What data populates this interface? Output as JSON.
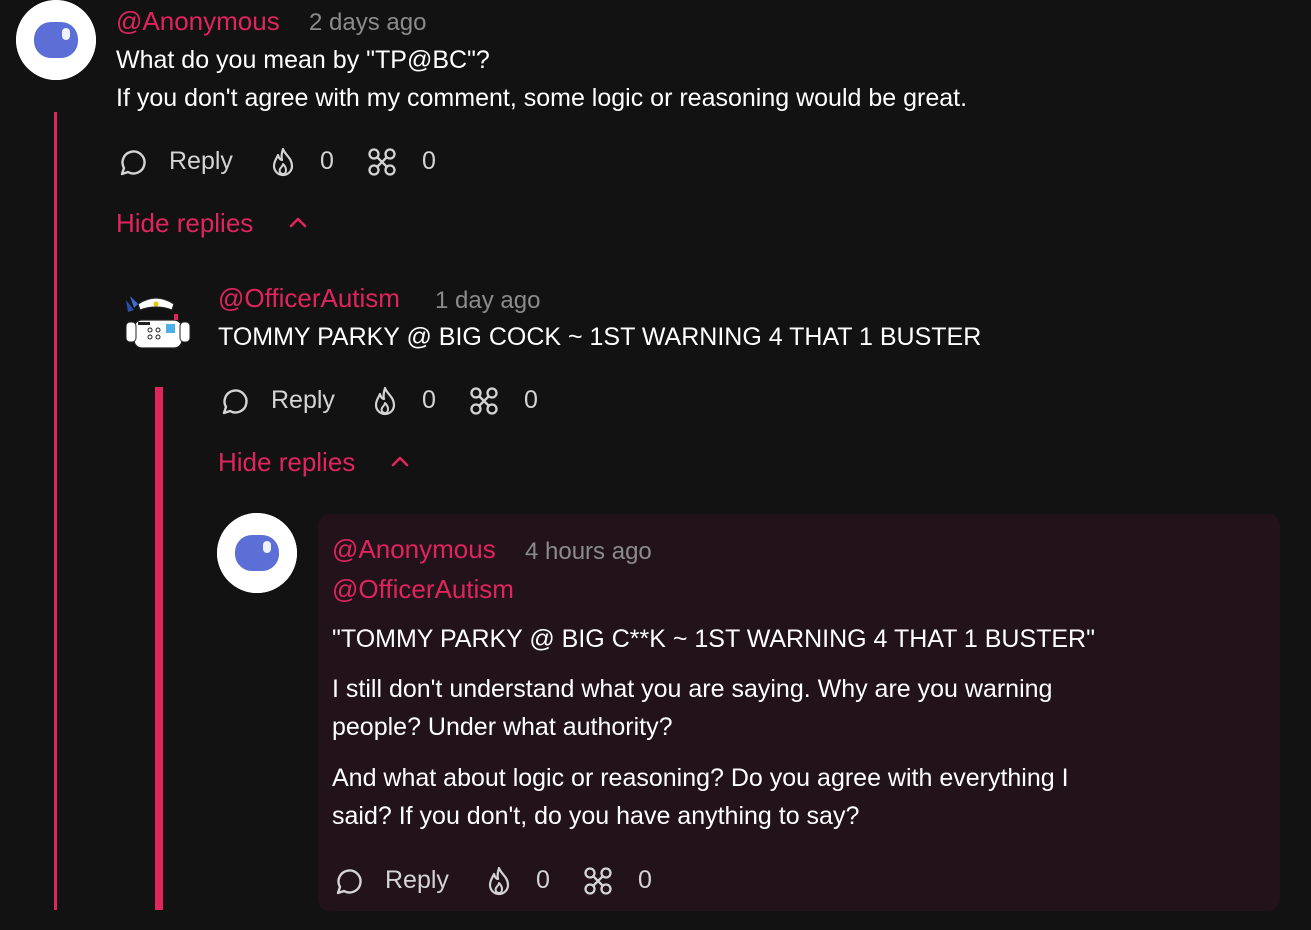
{
  "comments": [
    {
      "username": "@Anonymous",
      "timestamp": "2 days ago",
      "lines": [
        "What do you mean by \"TP@BC\"?",
        "If you don't agree with my comment, some logic or reasoning would be great."
      ],
      "reply_label": "Reply",
      "fire_count": "0",
      "bolt_count": "0",
      "hide_replies_label": "Hide replies"
    },
    {
      "username": "@OfficerAutism",
      "timestamp": "1 day ago",
      "lines": [
        "TOMMY PARKY @ BIG COCK ~ 1ST WARNING 4 THAT 1 BUSTER"
      ],
      "reply_label": "Reply",
      "fire_count": "0",
      "bolt_count": "0",
      "hide_replies_label": "Hide replies"
    },
    {
      "username": "@Anonymous",
      "timestamp": "4 hours ago",
      "mention": "@OfficerAutism",
      "quote": "\"TOMMY PARKY @ BIG C**K ~ 1ST WARNING 4 THAT 1 BUSTER\"",
      "para1": [
        "I still don't understand what you are saying. Why are you warning",
        "people? Under what authority?"
      ],
      "para2": [
        "And what about logic or reasoning? Do you agree with everything I",
        "said? If you don't, do you have anything to say?"
      ],
      "reply_label": "Reply",
      "fire_count": "0",
      "bolt_count": "0"
    }
  ],
  "colors": {
    "accent": "#e0245e",
    "background": "#121212",
    "reply_card_bg": "#22121a",
    "muted_text": "#8b8b8b",
    "avatar_bg": "#ffffff",
    "avatar_visor": "#5b6fd6"
  },
  "icons": {
    "reply": "reply-bubble-icon",
    "fire": "fire-icon",
    "bolt": "interact-icon",
    "chevron": "chevron-up-icon"
  }
}
